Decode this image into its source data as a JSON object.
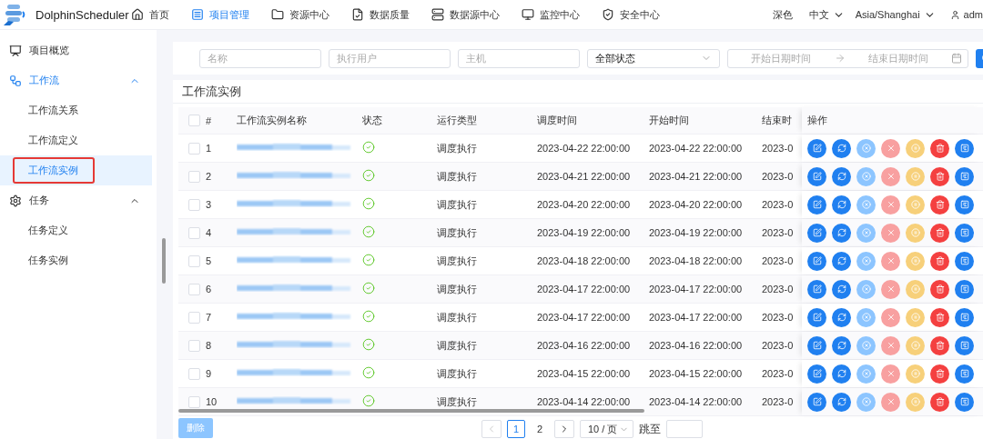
{
  "header": {
    "logo_text": "DolphinScheduler",
    "nav": [
      {
        "label": "首页",
        "selected": false
      },
      {
        "label": "项目管理",
        "selected": true
      },
      {
        "label": "资源中心",
        "selected": false
      },
      {
        "label": "数据质量",
        "selected": false
      },
      {
        "label": "数据源中心",
        "selected": false
      },
      {
        "label": "监控中心",
        "selected": false
      },
      {
        "label": "安全中心",
        "selected": false
      }
    ],
    "theme": "深色",
    "language": "中文",
    "timezone": "Asia/Shanghai",
    "user": "adm"
  },
  "sidebar": {
    "items": [
      {
        "label": "项目概览",
        "selected": false
      },
      {
        "label": "工作流",
        "selected": true,
        "expanded": true,
        "children": [
          {
            "label": "工作流关系",
            "selected": false,
            "highlighted": false
          },
          {
            "label": "工作流定义",
            "selected": false,
            "highlighted": false
          },
          {
            "label": "工作流实例",
            "selected": true,
            "highlighted": true
          }
        ]
      },
      {
        "label": "任务",
        "selected": false,
        "expanded": true,
        "children": [
          {
            "label": "任务定义",
            "selected": false,
            "highlighted": false
          },
          {
            "label": "任务实例",
            "selected": false,
            "highlighted": false
          }
        ]
      }
    ]
  },
  "filters": {
    "name_placeholder": "名称",
    "user_placeholder": "执行用户",
    "host_placeholder": "主机",
    "state_value": "全部状态",
    "start_placeholder": "开始日期时间",
    "end_placeholder": "结束日期时间"
  },
  "table": {
    "title": "工作流实例",
    "header_checked": false,
    "columns": [
      "#",
      "工作流实例名称",
      "状态",
      "运行类型",
      "调度时间",
      "开始时间",
      "结束时",
      "操作"
    ],
    "actions": [
      {
        "kind": "edit",
        "disabled": false
      },
      {
        "kind": "rerun",
        "disabled": false
      },
      {
        "kind": "recover",
        "disabled": true
      },
      {
        "kind": "stop",
        "disabled": true
      },
      {
        "kind": "pause",
        "disabled": true
      },
      {
        "kind": "delete",
        "disabled": false
      },
      {
        "kind": "gantt",
        "disabled": false
      }
    ],
    "rows": [
      {
        "index": "1",
        "checked": false,
        "success": true,
        "run_type": "调度执行",
        "schedule_time": "2023-04-22 22:00:00",
        "start_time": "2023-04-22 22:00:00",
        "end_time": "2023-0"
      },
      {
        "index": "2",
        "checked": false,
        "success": true,
        "run_type": "调度执行",
        "schedule_time": "2023-04-21 22:00:00",
        "start_time": "2023-04-21 22:00:00",
        "end_time": "2023-0"
      },
      {
        "index": "3",
        "checked": false,
        "success": true,
        "run_type": "调度执行",
        "schedule_time": "2023-04-20 22:00:00",
        "start_time": "2023-04-20 22:00:00",
        "end_time": "2023-0"
      },
      {
        "index": "4",
        "checked": false,
        "success": true,
        "run_type": "调度执行",
        "schedule_time": "2023-04-19 22:00:00",
        "start_time": "2023-04-19 22:00:00",
        "end_time": "2023-0"
      },
      {
        "index": "5",
        "checked": false,
        "success": true,
        "run_type": "调度执行",
        "schedule_time": "2023-04-18 22:00:00",
        "start_time": "2023-04-18 22:00:00",
        "end_time": "2023-0"
      },
      {
        "index": "6",
        "checked": false,
        "success": true,
        "run_type": "调度执行",
        "schedule_time": "2023-04-17 22:00:00",
        "start_time": "2023-04-17 22:00:00",
        "end_time": "2023-0"
      },
      {
        "index": "7",
        "checked": false,
        "success": true,
        "run_type": "调度执行",
        "schedule_time": "2023-04-17 22:00:00",
        "start_time": "2023-04-17 22:00:00",
        "end_time": "2023-0"
      },
      {
        "index": "8",
        "checked": false,
        "success": true,
        "run_type": "调度执行",
        "schedule_time": "2023-04-16 22:00:00",
        "start_time": "2023-04-16 22:00:00",
        "end_time": "2023-0"
      },
      {
        "index": "9",
        "checked": false,
        "success": true,
        "run_type": "调度执行",
        "schedule_time": "2023-04-15 22:00:00",
        "start_time": "2023-04-15 22:00:00",
        "end_time": "2023-0"
      },
      {
        "index": "10",
        "checked": false,
        "success": true,
        "run_type": "调度执行",
        "schedule_time": "2023-04-14 22:00:00",
        "start_time": "2023-04-14 22:00:00",
        "end_time": "2023-0"
      }
    ]
  },
  "footer": {
    "delete_label": "删除",
    "delete_disabled": true,
    "prev_disabled": true,
    "next_disabled": false,
    "pages": [
      {
        "label": "1",
        "selected": true
      },
      {
        "label": "2",
        "selected": false
      }
    ],
    "page_size": "10 / 页",
    "jump_label": "跳至"
  }
}
